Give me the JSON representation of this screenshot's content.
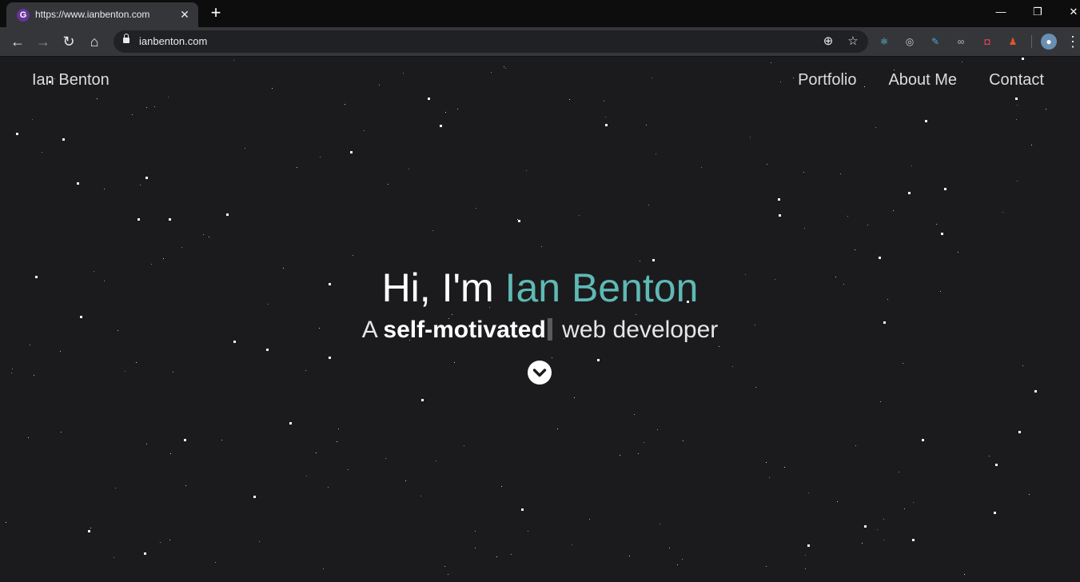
{
  "browser": {
    "tab": {
      "title": "https://www.ianbenton.com",
      "favicon_icon": "gatsby-icon",
      "favicon_letter": "G",
      "close_glyph": "✕"
    },
    "new_tab_glyph": "+",
    "window_controls": {
      "minimize": "—",
      "restore": "❐",
      "close": "✕"
    },
    "nav": {
      "back": "←",
      "forward": "→",
      "reload": "↻",
      "home": "⌂"
    },
    "address": {
      "url": "ianbenton.com"
    },
    "omnibox_icons": {
      "install": "⊕",
      "bookmark": "☆"
    },
    "menu_glyph": "⋮",
    "extensions": [
      {
        "name": "react-devtools-icon",
        "glyph": "⚛",
        "color": "#61dafb"
      },
      {
        "name": "target-icon",
        "glyph": "◎",
        "color": "#cccccc"
      },
      {
        "name": "eyedropper-icon",
        "glyph": "✎",
        "color": "#4fa3d9"
      },
      {
        "name": "incognito-icon",
        "glyph": "∞",
        "color": "#bbbbbb"
      },
      {
        "name": "pocket-icon",
        "glyph": "◘",
        "color": "#ef4056"
      },
      {
        "name": "mascot-icon",
        "glyph": "♟",
        "color": "#e0552a"
      }
    ],
    "avatar_glyph": "●"
  },
  "site": {
    "brand": "Ian Benton",
    "nav": [
      "Portfolio",
      "About Me",
      "Contact"
    ],
    "hero": {
      "greeting": "Hi, I'm ",
      "name": "Ian Benton",
      "sub_prefix": "A ",
      "sub_word": "self-motivated",
      "sub_suffix": " web developer"
    },
    "colors": {
      "background": "#1b1b1e",
      "accent": "#5fb9b5",
      "text": "#ffffff"
    }
  }
}
